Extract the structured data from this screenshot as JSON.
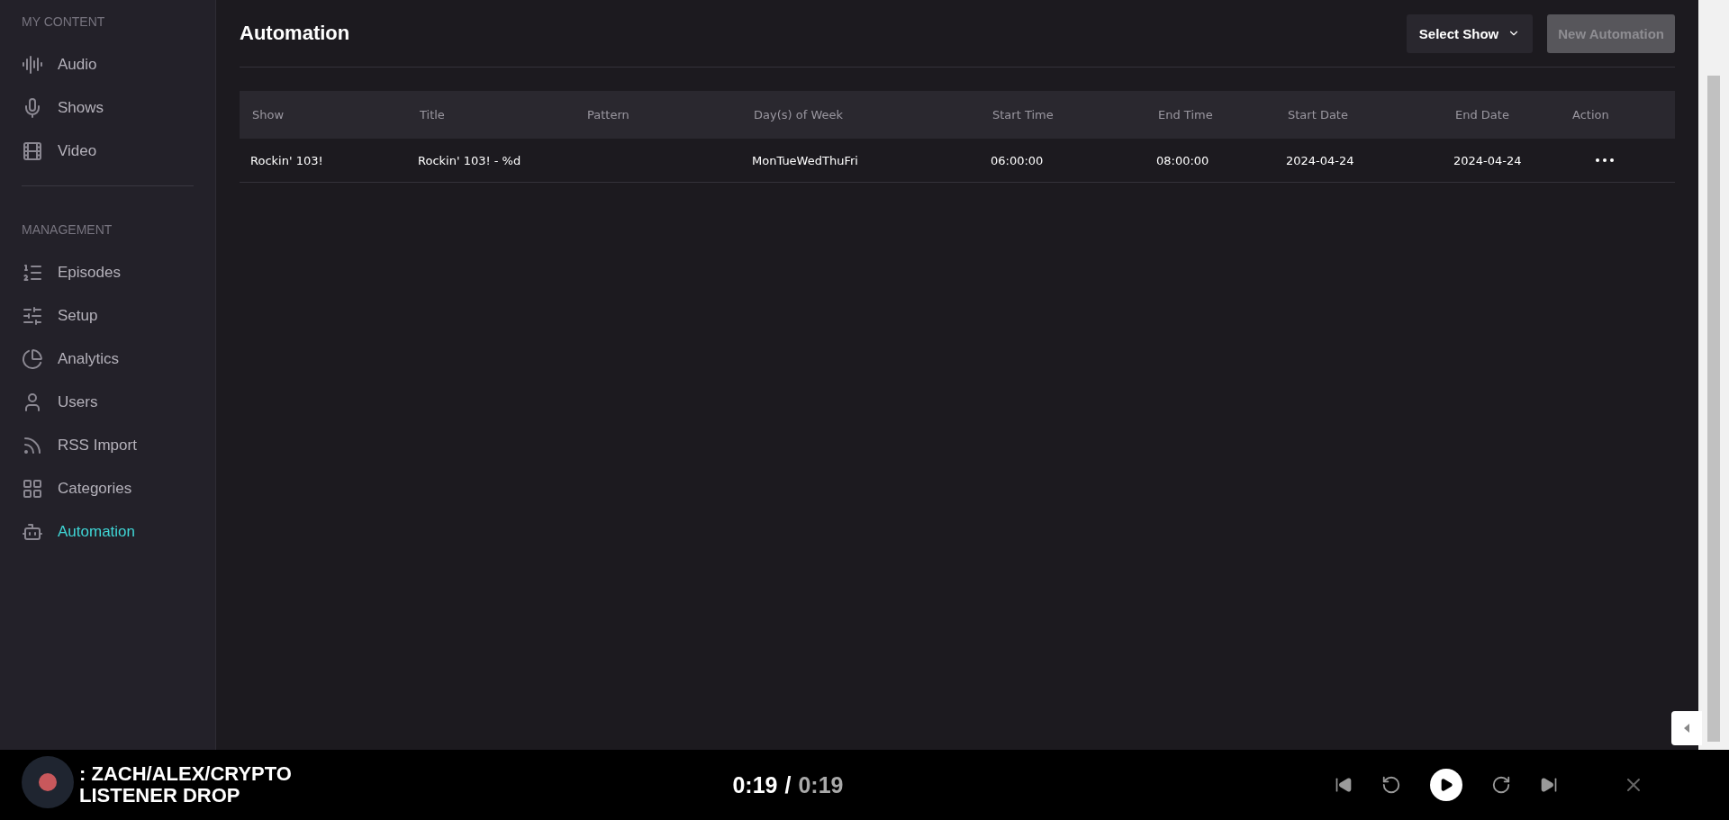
{
  "sidebar": {
    "sections": [
      {
        "heading": "MY CONTENT",
        "items": [
          {
            "label": "Audio",
            "selected": false
          },
          {
            "label": "Shows",
            "selected": false
          },
          {
            "label": "Video",
            "selected": false
          }
        ]
      },
      {
        "heading": "MANAGEMENT",
        "items": [
          {
            "label": "Episodes",
            "selected": false
          },
          {
            "label": "Setup",
            "selected": false
          },
          {
            "label": "Analytics",
            "selected": false
          },
          {
            "label": "Users",
            "selected": false
          },
          {
            "label": "RSS Import",
            "selected": false
          },
          {
            "label": "Categories",
            "selected": false
          },
          {
            "label": "Automation",
            "selected": true
          }
        ]
      }
    ]
  },
  "page": {
    "title": "Automation",
    "select_show": "Select Show",
    "new_button": {
      "label": "New Automation",
      "disabled": true
    }
  },
  "table": {
    "columns": [
      "Show",
      "Title",
      "Pattern",
      "Day(s) of Week",
      "Start Time",
      "End Time",
      "Start Date",
      "End Date",
      "Action"
    ],
    "rows": [
      {
        "cells": [
          "Rockin' 103!",
          "Rockin' 103! - %d",
          "",
          "MonTueWedThuFri",
          "06:00:00",
          "08:00:00",
          "2024-04-24",
          "2024-04-24"
        ]
      }
    ]
  },
  "player": {
    "title": ": ZACH/ALEX/CRYPTO LISTENER DROP",
    "elapsed": "0:19",
    "separator": "/",
    "duration": "0:19"
  }
}
